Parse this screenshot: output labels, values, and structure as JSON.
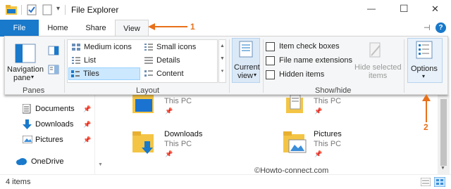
{
  "window": {
    "title": "File Explorer",
    "controls": {
      "minimize": "—",
      "maximize": "☐",
      "close": "✕"
    }
  },
  "quick_access": {
    "customize_symbol": "▾"
  },
  "tabs": [
    {
      "label": "File"
    },
    {
      "label": "Home"
    },
    {
      "label": "Share"
    },
    {
      "label": "View"
    }
  ],
  "ribbon_right": {
    "expand_symbol": "⊣",
    "help_symbol": "?"
  },
  "panes_group": {
    "label": "Panes",
    "navigation_pane_line1": "Navigation",
    "navigation_pane_line2": "pane",
    "dropdown": "▾"
  },
  "layout_group": {
    "label": "Layout",
    "items": [
      {
        "label": "Medium icons"
      },
      {
        "label": "Small icons"
      },
      {
        "label": "List"
      },
      {
        "label": "Details"
      },
      {
        "label": "Tiles"
      },
      {
        "label": "Content"
      }
    ],
    "selected": "Tiles"
  },
  "current_view": {
    "line1": "Current",
    "line2": "view"
  },
  "showhide_group": {
    "label": "Show/hide",
    "checkboxes": [
      {
        "label": "Item check boxes"
      },
      {
        "label": "File name extensions"
      },
      {
        "label": "Hidden items"
      }
    ],
    "hide_selected_line1": "Hide selected",
    "hide_selected_line2": "items"
  },
  "options": {
    "label": "Options"
  },
  "nav_items": [
    {
      "label": "Documents"
    },
    {
      "label": "Downloads"
    },
    {
      "label": "Pictures"
    },
    {
      "label": "OneDrive"
    }
  ],
  "tiles": [
    {
      "name": "",
      "sub": "This PC"
    },
    {
      "name": "",
      "sub": "This PC"
    },
    {
      "name": "Downloads",
      "sub": "This PC"
    },
    {
      "name": "Pictures",
      "sub": "This PC"
    }
  ],
  "annotations": {
    "one": "1",
    "two": "2"
  },
  "watermark": "©Howto-connect.com",
  "status": {
    "items": "4 items"
  },
  "colors": {
    "accent": "#1979ca",
    "file_tab": "#1979ca",
    "annotation": "#e8701a",
    "selected_bg": "#cce8ff",
    "selected_border": "#99d1ff"
  },
  "icons": {
    "pin": "📌"
  }
}
